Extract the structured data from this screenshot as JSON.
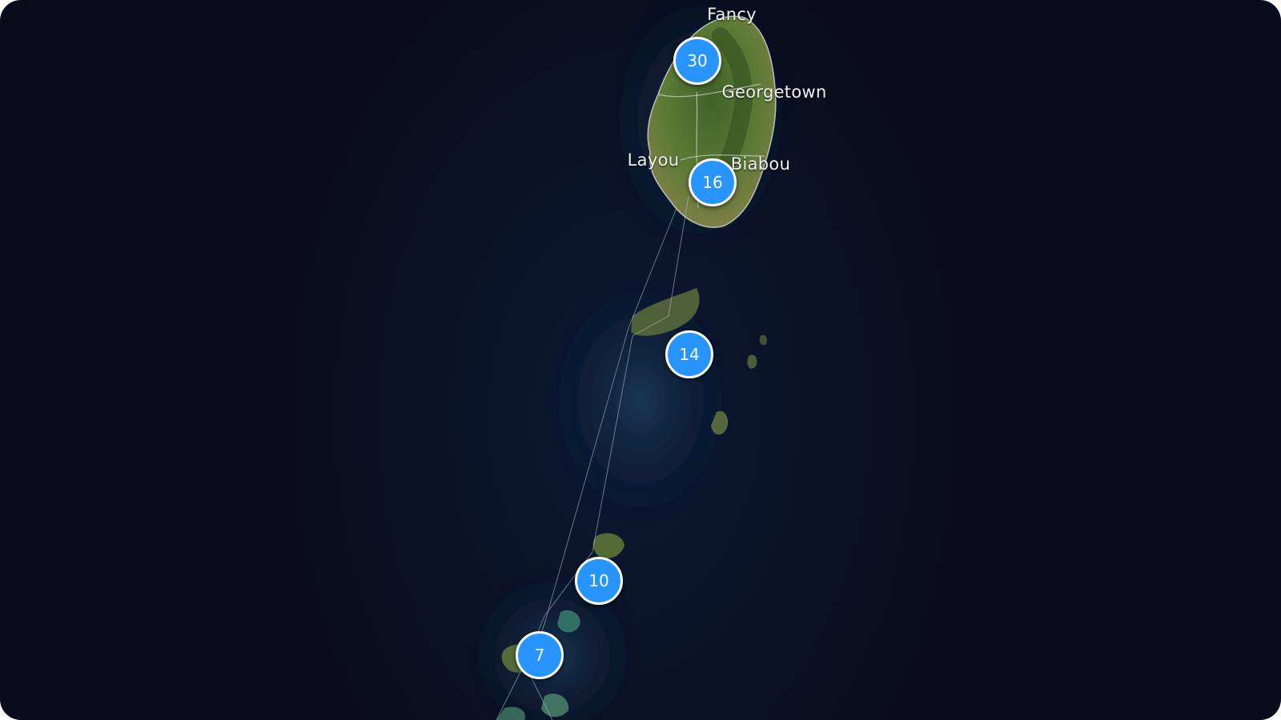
{
  "map": {
    "labels": {
      "fancy": "Fancy",
      "georgetown": "Georgetown",
      "layou": "Layou",
      "biabou": "Biabou"
    },
    "clusters": [
      {
        "count": "30"
      },
      {
        "count": "16"
      },
      {
        "count": "14"
      },
      {
        "count": "10"
      },
      {
        "count": "7"
      }
    ],
    "colors": {
      "ocean": "#090d1b",
      "cluster_fill": "#2794ff",
      "cluster_border": "#ffffff",
      "land": "#4c6a30"
    }
  }
}
